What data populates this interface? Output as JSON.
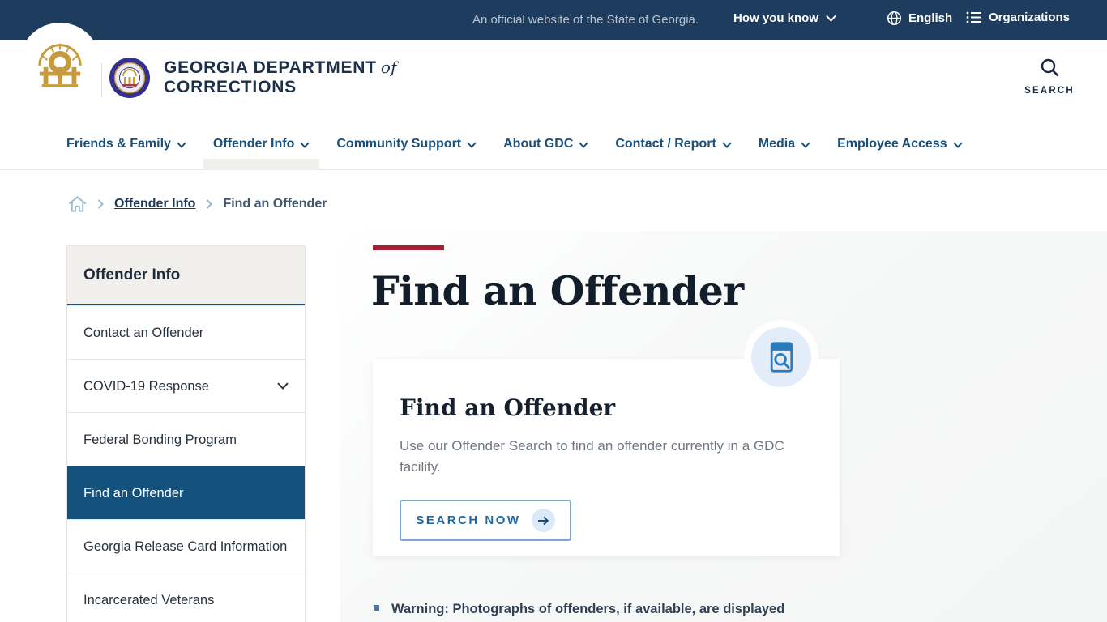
{
  "topbar": {
    "official_text": "An official website of the State of Georgia.",
    "how_you_know_label": "How you know",
    "language_label": "English",
    "organizations_label": "Organizations"
  },
  "header": {
    "org_name_line1": "GEORGIA DEPARTMENT",
    "org_name_connector": "of",
    "org_name_line2": "CORRECTIONS",
    "search_label": "SEARCH"
  },
  "nav": {
    "items": [
      {
        "label": "Friends & Family",
        "active": false
      },
      {
        "label": "Offender Info",
        "active": true
      },
      {
        "label": "Community Support",
        "active": false
      },
      {
        "label": "About GDC",
        "active": false
      },
      {
        "label": "Contact / Report",
        "active": false
      },
      {
        "label": "Media",
        "active": false
      },
      {
        "label": "Employee Access",
        "active": false
      }
    ]
  },
  "breadcrumb": {
    "link_label": "Offender Info",
    "current_label": "Find an Offender"
  },
  "sidebar": {
    "title": "Offender Info",
    "items": [
      {
        "label": "Contact an Offender",
        "active": false,
        "expandable": false
      },
      {
        "label": "COVID-19 Response",
        "active": false,
        "expandable": true
      },
      {
        "label": "Federal Bonding Program",
        "active": false,
        "expandable": false
      },
      {
        "label": "Find an Offender",
        "active": true,
        "expandable": false
      },
      {
        "label": "Georgia Release Card Information",
        "active": false,
        "expandable": false
      },
      {
        "label": "Incarcerated Veterans",
        "active": false,
        "expandable": false,
        "partially_visible": true
      }
    ]
  },
  "main": {
    "page_title": "Find an Offender",
    "card": {
      "title": "Find an Offender",
      "description": "Use our Offender Search to find an offender currently in a GDC facility.",
      "button_label": "SEARCH NOW"
    },
    "warning_text": "Warning: Photographs of offenders, if available, are displayed"
  },
  "colors": {
    "topbar_navy": "#1E3C5E",
    "accent_red": "#A41E35",
    "nav_link_blue": "#194F7B",
    "sidebar_active_blue": "#14517C",
    "sidebar_header_bg": "#F1EFEC",
    "icon_blue": "#2B7ABC",
    "logo_gold": "#C79B3B"
  }
}
